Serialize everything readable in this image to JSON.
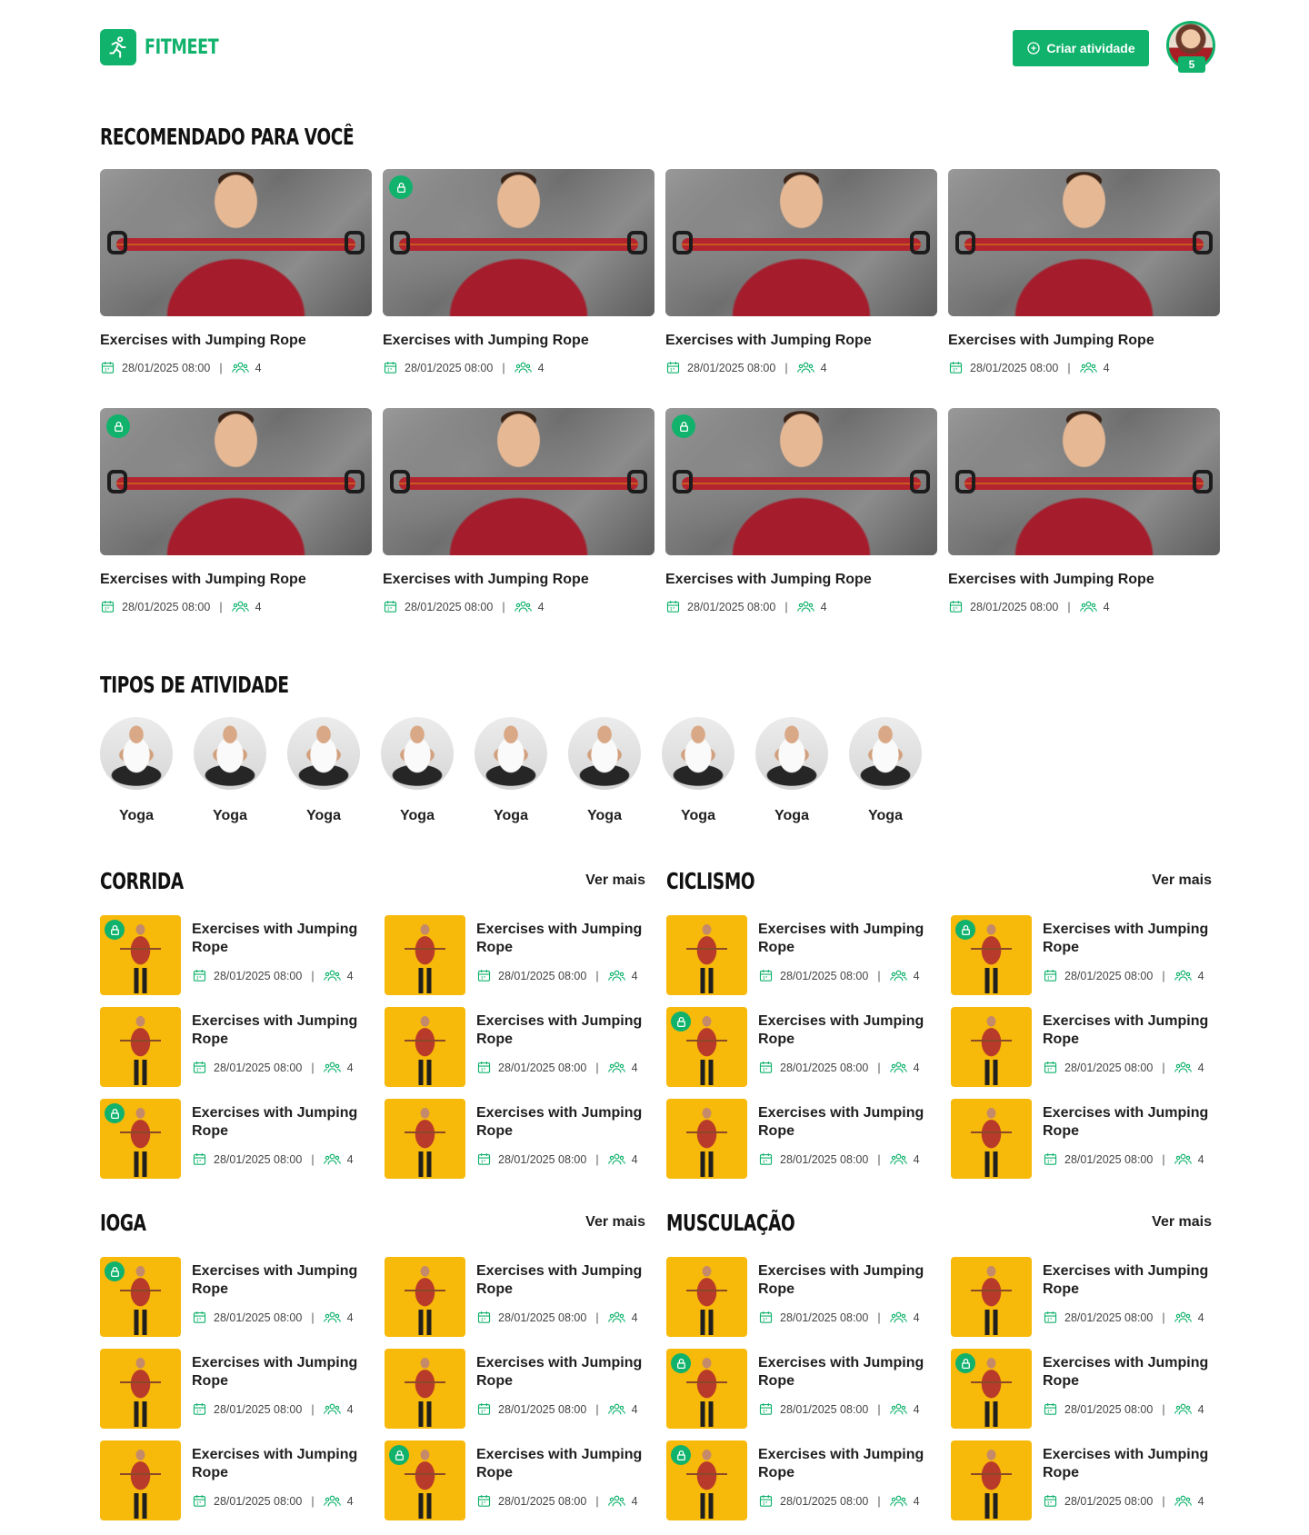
{
  "brand": {
    "name": "FITMEET",
    "accent": "#10b26c"
  },
  "header": {
    "create_label": "Criar atividade",
    "notifications": "5"
  },
  "recommended": {
    "title": "Recomendado para você",
    "cards": [
      {
        "title": "Exercises with Jumping Rope",
        "date": "28/01/2025 08:00",
        "people": "4",
        "locked": false
      },
      {
        "title": "Exercises with Jumping Rope",
        "date": "28/01/2025 08:00",
        "people": "4",
        "locked": true
      },
      {
        "title": "Exercises with Jumping Rope",
        "date": "28/01/2025 08:00",
        "people": "4",
        "locked": false
      },
      {
        "title": "Exercises with Jumping Rope",
        "date": "28/01/2025 08:00",
        "people": "4",
        "locked": false
      },
      {
        "title": "Exercises with Jumping Rope",
        "date": "28/01/2025 08:00",
        "people": "4",
        "locked": true
      },
      {
        "title": "Exercises with Jumping Rope",
        "date": "28/01/2025 08:00",
        "people": "4",
        "locked": false
      },
      {
        "title": "Exercises with Jumping Rope",
        "date": "28/01/2025 08:00",
        "people": "4",
        "locked": true
      },
      {
        "title": "Exercises with Jumping Rope",
        "date": "28/01/2025 08:00",
        "people": "4",
        "locked": false
      }
    ]
  },
  "types": {
    "title": "Tipos de atividade",
    "items": [
      "Yoga",
      "Yoga",
      "Yoga",
      "Yoga",
      "Yoga",
      "Yoga",
      "Yoga",
      "Yoga",
      "Yoga"
    ]
  },
  "categories": [
    {
      "title": "Corrida",
      "more": "Ver mais",
      "items": [
        {
          "title": "Exercises with Jumping Rope",
          "date": "28/01/2025 08:00",
          "people": "4",
          "locked": true
        },
        {
          "title": "Exercises with Jumping Rope",
          "date": "28/01/2025 08:00",
          "people": "4",
          "locked": false
        },
        {
          "title": "Exercises with Jumping Rope",
          "date": "28/01/2025 08:00",
          "people": "4",
          "locked": false
        },
        {
          "title": "Exercises with Jumping Rope",
          "date": "28/01/2025 08:00",
          "people": "4",
          "locked": false
        },
        {
          "title": "Exercises with Jumping Rope",
          "date": "28/01/2025 08:00",
          "people": "4",
          "locked": true
        },
        {
          "title": "Exercises with Jumping Rope",
          "date": "28/01/2025 08:00",
          "people": "4",
          "locked": false
        }
      ]
    },
    {
      "title": "Ciclismo",
      "more": "Ver mais",
      "items": [
        {
          "title": "Exercises with Jumping Rope",
          "date": "28/01/2025 08:00",
          "people": "4",
          "locked": false
        },
        {
          "title": "Exercises with Jumping Rope",
          "date": "28/01/2025 08:00",
          "people": "4",
          "locked": true
        },
        {
          "title": "Exercises with Jumping Rope",
          "date": "28/01/2025 08:00",
          "people": "4",
          "locked": true
        },
        {
          "title": "Exercises with Jumping Rope",
          "date": "28/01/2025 08:00",
          "people": "4",
          "locked": false
        },
        {
          "title": "Exercises with Jumping Rope",
          "date": "28/01/2025 08:00",
          "people": "4",
          "locked": false
        },
        {
          "title": "Exercises with Jumping Rope",
          "date": "28/01/2025 08:00",
          "people": "4",
          "locked": false
        }
      ]
    },
    {
      "title": "Ioga",
      "more": "Ver mais",
      "items": [
        {
          "title": "Exercises with Jumping Rope",
          "date": "28/01/2025 08:00",
          "people": "4",
          "locked": true
        },
        {
          "title": "Exercises with Jumping Rope",
          "date": "28/01/2025 08:00",
          "people": "4",
          "locked": false
        },
        {
          "title": "Exercises with Jumping Rope",
          "date": "28/01/2025 08:00",
          "people": "4",
          "locked": false
        },
        {
          "title": "Exercises with Jumping Rope",
          "date": "28/01/2025 08:00",
          "people": "4",
          "locked": false
        },
        {
          "title": "Exercises with Jumping Rope",
          "date": "28/01/2025 08:00",
          "people": "4",
          "locked": false
        },
        {
          "title": "Exercises with Jumping Rope",
          "date": "28/01/2025 08:00",
          "people": "4",
          "locked": true
        }
      ]
    },
    {
      "title": "Musculação",
      "more": "Ver mais",
      "items": [
        {
          "title": "Exercises with Jumping Rope",
          "date": "28/01/2025 08:00",
          "people": "4",
          "locked": false
        },
        {
          "title": "Exercises with Jumping Rope",
          "date": "28/01/2025 08:00",
          "people": "4",
          "locked": false
        },
        {
          "title": "Exercises with Jumping Rope",
          "date": "28/01/2025 08:00",
          "people": "4",
          "locked": true
        },
        {
          "title": "Exercises with Jumping Rope",
          "date": "28/01/2025 08:00",
          "people": "4",
          "locked": true
        },
        {
          "title": "Exercises with Jumping Rope",
          "date": "28/01/2025 08:00",
          "people": "4",
          "locked": true
        },
        {
          "title": "Exercises with Jumping Rope",
          "date": "28/01/2025 08:00",
          "people": "4",
          "locked": false
        }
      ]
    }
  ]
}
